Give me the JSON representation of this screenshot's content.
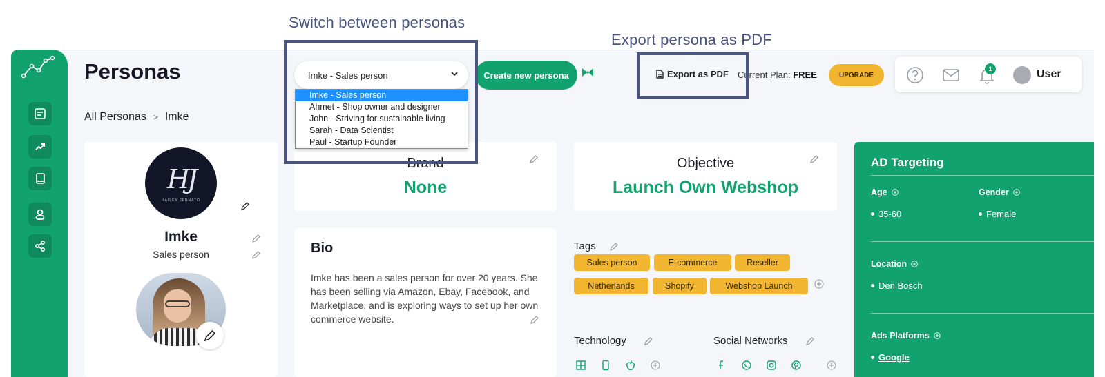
{
  "annotations": {
    "switch_caption": "Switch between personas",
    "export_caption": "Export persona as PDF"
  },
  "header": {
    "title": "Personas",
    "breadcrumb": {
      "root": "All Personas",
      "separator": ">",
      "current": "Imke"
    },
    "persona_select": {
      "selected": "Imke - Sales person",
      "options": [
        "Imke - Sales person",
        "Ahmet - Shop owner and designer",
        "John - Striving for sustainable living",
        "Sarah - Data Scientist",
        "Paul - Startup Founder"
      ]
    },
    "create_button": "Create new persona",
    "export_button": "Export as PDF",
    "plan_label": "Current Plan:",
    "plan_value": "FREE",
    "upgrade_button": "UPGRADE",
    "notification_count": "1",
    "user_name": "User"
  },
  "sidebar": {
    "items": [
      {
        "icon": "notes-icon"
      },
      {
        "icon": "trend-icon"
      },
      {
        "icon": "book-icon"
      },
      {
        "icon": "persona-icon"
      },
      {
        "icon": "share-icon"
      }
    ]
  },
  "profile": {
    "logo_monogram": "HJ",
    "logo_subtitle": "HAILEY JENNATO",
    "name": "Imke",
    "role": "Sales person"
  },
  "brand": {
    "label": "Brand",
    "value": "None"
  },
  "objective": {
    "label": "Objective",
    "value": "Launch Own Webshop"
  },
  "bio": {
    "title": "Bio",
    "text": "Imke has been a sales person for over 20 years. She has been selling via Amazon, Ebay, Facebook, and Marketplace, and is exploring ways to set up her own commerce website."
  },
  "tags": {
    "title": "Tags",
    "items": [
      "Sales person",
      "E-commerce",
      "Reseller",
      "Netherlands",
      "Shopify",
      "Webshop Launch"
    ]
  },
  "technology": {
    "title": "Technology"
  },
  "social": {
    "title": "Social Networks"
  },
  "ad_targeting": {
    "title": "AD Targeting",
    "age_label": "Age",
    "age_value": "35-60",
    "gender_label": "Gender",
    "gender_value": "Female",
    "location_label": "Location",
    "location_value": "Den Bosch",
    "platforms_label": "Ads Platforms",
    "platforms_value": "Google"
  },
  "colors": {
    "brand_green": "#12a26e",
    "tag_yellow": "#f2b530",
    "annotation": "#4a5480",
    "dropdown_highlight": "#1e90ff"
  }
}
